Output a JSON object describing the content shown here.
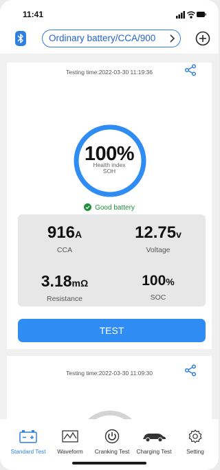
{
  "status_bar": {
    "time": "11:41",
    "icons": [
      "signal-icon",
      "wifi-icon",
      "battery-icon"
    ]
  },
  "header": {
    "battery_type": "Ordinary battery/CCA/900",
    "left_icon": "bluetooth-icon",
    "right_icon": "add-icon"
  },
  "colors": {
    "accent": "#2f8cf2",
    "good": "#1e8f3a",
    "panel": "#e7e7e7"
  },
  "results": [
    {
      "testing_time": "Testing time:2022-03-30 11:19:36",
      "health_value": "100%",
      "health_fraction": 1.0,
      "health_label": "Health index",
      "health_sublabel": "SOH",
      "status": "Good battery",
      "metrics": {
        "cca": {
          "value": "916",
          "unit": "A",
          "label": "CCA"
        },
        "voltage": {
          "value": "12.75",
          "unit": "v",
          "label": "Voltage"
        },
        "resistance": {
          "value": "3.18",
          "unit": "mΩ",
          "label": "Resistance"
        },
        "soc": {
          "value": "100",
          "unit": "%",
          "label": "SOC"
        }
      },
      "button_label": "TEST"
    },
    {
      "testing_time": "Testing time:2022-03-30 11:09:30"
    }
  ],
  "tabs": [
    {
      "label": "Standard Test",
      "icon": "battery-icon",
      "active": true
    },
    {
      "label": "Waveform",
      "icon": "waveform-icon",
      "active": false
    },
    {
      "label": "Cranking Test",
      "icon": "power-icon",
      "active": false
    },
    {
      "label": "Charging Test",
      "icon": "car-icon",
      "active": false
    },
    {
      "label": "Setting",
      "icon": "gear-icon",
      "active": false
    }
  ]
}
